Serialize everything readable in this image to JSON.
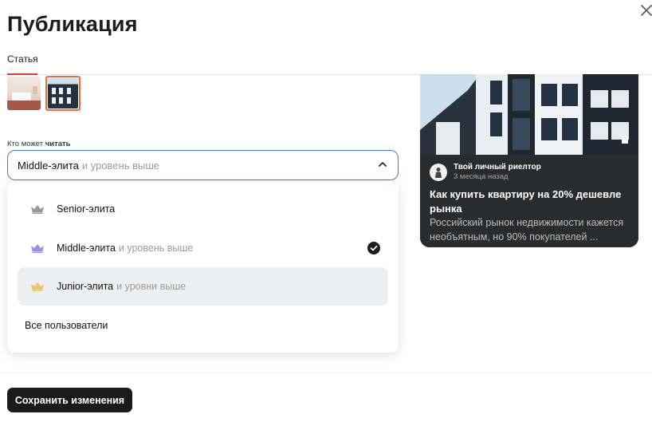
{
  "header": {
    "title": "Публикация"
  },
  "tabs": [
    {
      "label": "Статья",
      "active": true
    }
  ],
  "access": {
    "label_prefix": "Кто может ",
    "label_bold": "читать",
    "selected_main": "Middle-элита",
    "selected_suffix": "и уровень выше",
    "options": [
      {
        "main": "Senior-элита",
        "suffix": "",
        "icon": "crown-icon",
        "color": "#9a9a9a",
        "selected": false,
        "highlighted": false
      },
      {
        "main": "Middle-элита",
        "suffix": "и уровень выше",
        "icon": "crown-icon",
        "color": "#9c8fe0",
        "selected": true,
        "highlighted": false
      },
      {
        "main": "Junior-элита",
        "suffix": "и уровни выше",
        "icon": "crown-icon",
        "color": "#e8c66b",
        "selected": false,
        "highlighted": true
      },
      {
        "main": "Все пользователи",
        "suffix": "",
        "icon": "",
        "color": "",
        "selected": false,
        "highlighted": false
      }
    ]
  },
  "preview": {
    "author": "Твой личный риелтор",
    "time": "3 месяца назад",
    "title": "Как купить квартиру на 20% дешевле рынка",
    "description": "Российский рынок недвижимости кажется необъятным, но 90% покупателей ..."
  },
  "footer": {
    "save_label": "Сохранить изменения"
  },
  "colors": {
    "accent_blue": "#3d7fd6",
    "tab_underline": "#e53935",
    "thumb_selected": "#f06b3b",
    "button_dark": "#1b1b1b"
  }
}
